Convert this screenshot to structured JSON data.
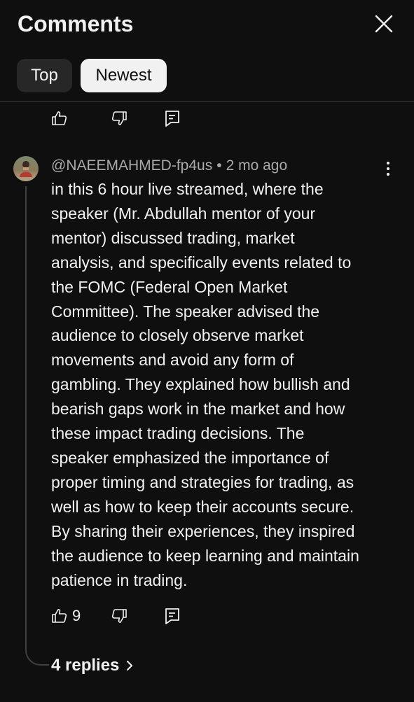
{
  "header": {
    "title": "Comments",
    "close_icon": "close-icon"
  },
  "tabs": {
    "top_label": "Top",
    "newest_label": "Newest",
    "selected": "Newest"
  },
  "previous_comment_actions": {
    "icons": [
      "thumbs-up-icon",
      "thumbs-down-icon",
      "reply-icon"
    ]
  },
  "comment": {
    "author": "@NAEEMAHMED-fp4us",
    "separator": "•",
    "time": "2 mo ago",
    "text": "in this 6 hour live streamed, where the\nspeaker (Mr. Abdullah mentor of your\nmentor) discussed trading, market\nanalysis, and specifically events related to\nthe FOMC (Federal Open Market\nCommittee). The speaker advised the\naudience to closely observe market\nmovements and avoid any form of\ngambling. They explained how bullish and\nbearish gaps work in the market and how\nthese impact trading decisions. The\nspeaker emphasized the importance of\nproper timing and strategies for trading, as\nwell as how to keep their accounts secure.\nBy sharing their experiences, they inspired\nthe audience to keep learning and maintain\npatience in trading.",
    "like_count": "9",
    "replies_label": "4 replies",
    "more_icon": "more-vertical-icon"
  },
  "colors": {
    "background": "#0f0f0f",
    "text_primary": "#f1f1f1",
    "text_secondary": "#aaaaaa",
    "chip_inactive": "#272727",
    "chip_active": "#f1f1f1",
    "divider": "#3a3a3a"
  }
}
